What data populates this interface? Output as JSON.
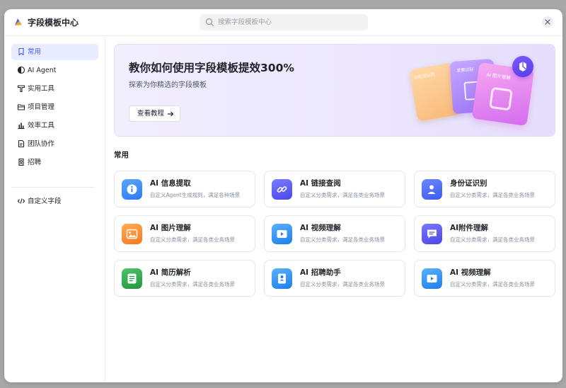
{
  "header": {
    "title": "字段模板中心",
    "search_placeholder": "搜索字段模板中心"
  },
  "sidebar": {
    "items": [
      {
        "label": "常用",
        "icon": "bookmark-icon",
        "active": true
      },
      {
        "label": "AI Agent",
        "icon": "ai-agent-icon",
        "active": false
      },
      {
        "label": "实用工具",
        "icon": "tool-icon",
        "active": false
      },
      {
        "label": "项目管理",
        "icon": "folder-icon",
        "active": false
      },
      {
        "label": "效率工具",
        "icon": "bar-chart-icon",
        "active": false
      },
      {
        "label": "团队协作",
        "icon": "document-icon",
        "active": false
      },
      {
        "label": "招聘",
        "icon": "recruit-icon",
        "active": false
      }
    ],
    "custom": {
      "label": "自定义字段",
      "icon": "code-icon"
    }
  },
  "banner": {
    "title": "教你如何使用字段模板提效300%",
    "subtitle": "探索为你精选的字段模板",
    "button_label": "查看教程",
    "art_labels": [
      "AI生成公式",
      "发票识别",
      "AI 图片理解"
    ]
  },
  "section": {
    "title": "常用"
  },
  "cards": [
    {
      "title": "AI 信息提取",
      "desc": "自定义Agent生成规则，满足各种场景",
      "icon": "info-extract-icon",
      "color": "#3d8bfd"
    },
    {
      "title": "AI 链接查阅",
      "desc": "自定义分类需求，满足各类业务场景",
      "icon": "link-icon",
      "color": "#5b5ff5"
    },
    {
      "title": "身份证识别",
      "desc": "自定义分类需求，满足各类业务场景",
      "icon": "id-card-icon",
      "color": "#4b6bf5"
    },
    {
      "title": "AI 图片理解",
      "desc": "自定义分类需求，满足各类业务场景",
      "icon": "image-icon",
      "color": "#f5872a"
    },
    {
      "title": "AI 视频理解",
      "desc": "自定义分类需求，满足各类业务场景",
      "icon": "video-icon",
      "color": "#2e8ff0"
    },
    {
      "title": "AI附件理解",
      "desc": "自定义分类需求，满足各类业务场景",
      "icon": "attachment-icon",
      "color": "#5a57f0"
    },
    {
      "title": "AI 简历解析",
      "desc": "自定义分类需求，满足各类业务场景",
      "icon": "resume-icon",
      "color": "#2fa84f"
    },
    {
      "title": "AI 招聘助手",
      "desc": "自定义分类需求，满足各类业务场景",
      "icon": "recruit-assistant-icon",
      "color": "#2e8ff0"
    },
    {
      "title": "AI 视频理解",
      "desc": "自定义分类需求，满足各类业务场景",
      "icon": "video-icon",
      "color": "#2e8ff0"
    }
  ]
}
